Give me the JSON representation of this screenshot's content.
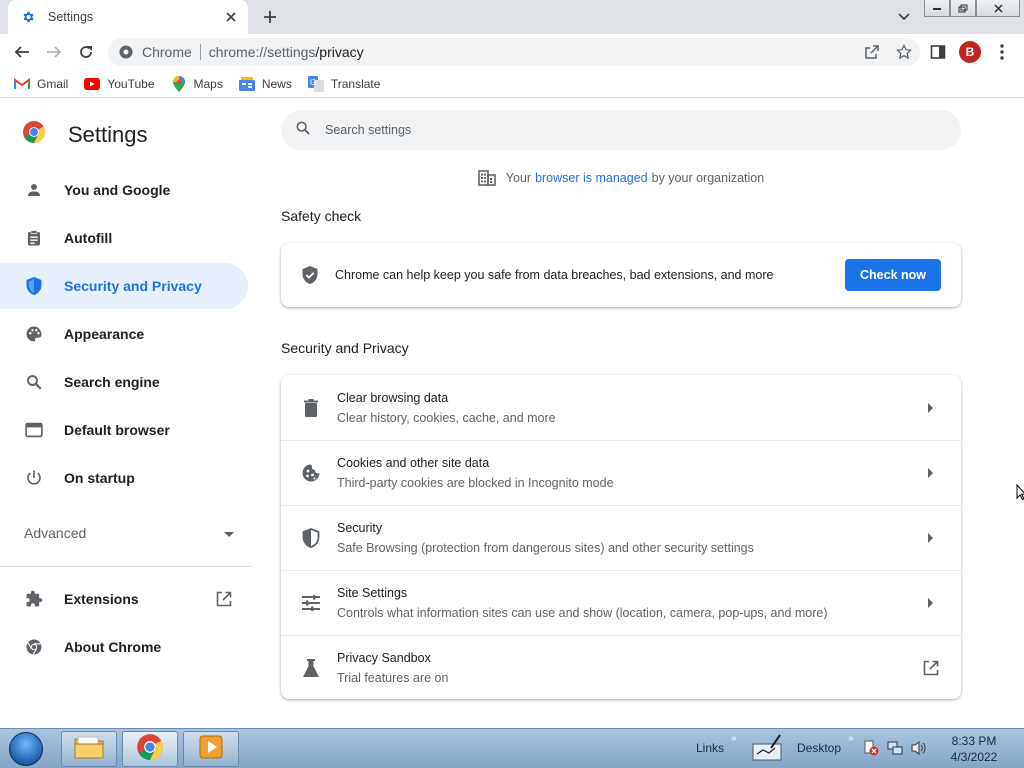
{
  "browser": {
    "tab_title": "Settings",
    "omnibox_chip": "Chrome",
    "url_host": "chrome://settings",
    "url_path": "/privacy",
    "profile_initial": "B"
  },
  "bookmarks": [
    {
      "label": "Gmail",
      "icon": "gmail-icon"
    },
    {
      "label": "YouTube",
      "icon": "youtube-icon"
    },
    {
      "label": "Maps",
      "icon": "maps-icon"
    },
    {
      "label": "News",
      "icon": "news-icon"
    },
    {
      "label": "Translate",
      "icon": "translate-icon"
    }
  ],
  "sidebar": {
    "title": "Settings",
    "items": [
      {
        "label": "You and Google",
        "icon": "person-icon"
      },
      {
        "label": "Autofill",
        "icon": "clipboard-icon"
      },
      {
        "label": "Security and Privacy",
        "icon": "shield-icon",
        "active": true
      },
      {
        "label": "Appearance",
        "icon": "palette-icon"
      },
      {
        "label": "Search engine",
        "icon": "search-icon"
      },
      {
        "label": "Default browser",
        "icon": "browser-window-icon"
      },
      {
        "label": "On startup",
        "icon": "power-icon"
      }
    ],
    "advanced_label": "Advanced",
    "extensions_label": "Extensions",
    "about_label": "About Chrome"
  },
  "main": {
    "search_placeholder": "Search settings",
    "managed_prefix": "Your",
    "managed_link": "browser is managed",
    "managed_suffix": "by your organization",
    "safety_title": "Safety check",
    "safety_text": "Chrome can help keep you safe from data breaches, bad extensions, and more",
    "check_now_label": "Check now",
    "privacy_title": "Security and Privacy",
    "rows": [
      {
        "title": "Clear browsing data",
        "subtitle": "Clear history, cookies, cache, and more",
        "icon": "trash-icon",
        "action": "arrow"
      },
      {
        "title": "Cookies and other site data",
        "subtitle": "Third-party cookies are blocked in Incognito mode",
        "icon": "cookie-icon",
        "action": "arrow"
      },
      {
        "title": "Security",
        "subtitle": "Safe Browsing (protection from dangerous sites) and other security settings",
        "icon": "shield-half-icon",
        "action": "arrow"
      },
      {
        "title": "Site Settings",
        "subtitle": "Controls what information sites can use and show (location, camera, pop-ups, and more)",
        "icon": "tune-icon",
        "action": "arrow"
      },
      {
        "title": "Privacy Sandbox",
        "subtitle": "Trial features are on",
        "icon": "flask-icon",
        "action": "external"
      }
    ]
  },
  "taskbar": {
    "links_label": "Links",
    "desktop_label": "Desktop",
    "time": "8:33 PM",
    "date": "4/3/2022"
  },
  "colors": {
    "accent": "#1a73e8",
    "active_nav_bg": "#e8f0fe",
    "avatar": "#c5221f"
  }
}
